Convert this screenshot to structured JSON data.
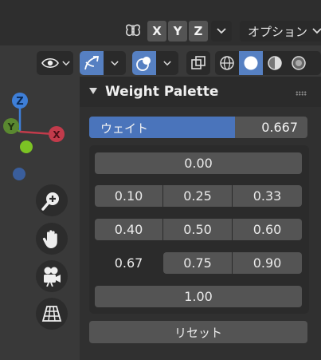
{
  "header": {
    "axes": [
      "X",
      "Y",
      "Z"
    ],
    "options_label": "オプション"
  },
  "panel": {
    "title": "Weight Palette",
    "weight_label": "ウェイト",
    "weight_value": "0.667",
    "weight_fraction": 0.667,
    "rows": [
      [
        "0.00"
      ],
      [
        "0.10",
        "0.25",
        "0.33"
      ],
      [
        "0.40",
        "0.50",
        "0.60"
      ],
      [
        "0.67",
        "0.75",
        "0.90"
      ],
      [
        "1.00"
      ]
    ],
    "reset_label": "リセット"
  },
  "gizmo": {
    "z": "Z",
    "y": "Y",
    "x": "X",
    "colors": {
      "x": "#c23b4b",
      "y": "#6a9a35",
      "z": "#3e7fd8",
      "active": "#7cc324",
      "neg": "#3a5e9c"
    }
  }
}
